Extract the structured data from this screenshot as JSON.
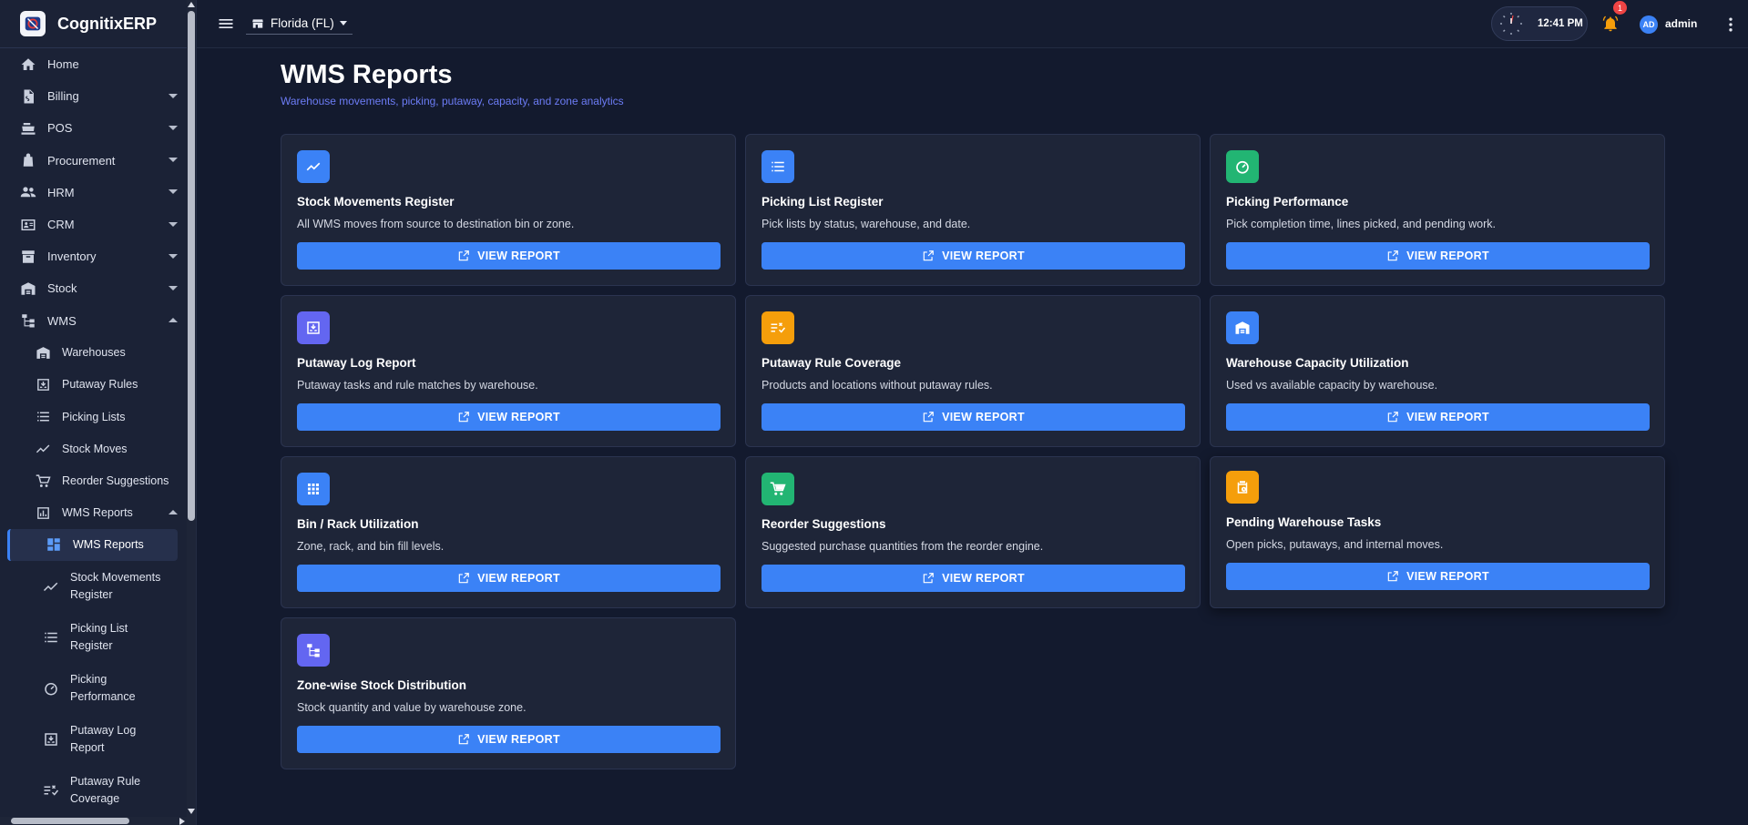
{
  "brand": {
    "name": "CognitixERP",
    "logo_icon": "cognitix-logo-icon"
  },
  "sidebar": {
    "items": [
      {
        "label": "Home",
        "icon": "home-icon"
      },
      {
        "label": "Billing",
        "icon": "receipt-icon"
      },
      {
        "label": "POS",
        "icon": "register-icon"
      },
      {
        "label": "Procurement",
        "icon": "bag-icon"
      },
      {
        "label": "HRM",
        "icon": "people-icon"
      },
      {
        "label": "CRM",
        "icon": "contact-card-icon"
      },
      {
        "label": "Inventory",
        "icon": "inventory-box-icon"
      },
      {
        "label": "Stock",
        "icon": "warehouse-icon"
      },
      {
        "label": "WMS",
        "icon": "hierarchy-icon"
      }
    ],
    "wms_children": [
      {
        "label": "Warehouses",
        "icon": "warehouse-icon"
      },
      {
        "label": "Putaway Rules",
        "icon": "putaway-icon"
      },
      {
        "label": "Picking Lists",
        "icon": "list-icon"
      },
      {
        "label": "Stock Moves",
        "icon": "trend-line-icon"
      },
      {
        "label": "Reorder Suggestions",
        "icon": "cart-icon"
      },
      {
        "label": "WMS Reports",
        "icon": "bar-chart-icon"
      }
    ],
    "report_children": [
      {
        "label": "WMS Reports",
        "icon": "dashboard-icon"
      },
      {
        "label_line1": "Stock Movements",
        "label_line2": "Register",
        "icon": "trend-line-icon"
      },
      {
        "label_line1": "Picking List",
        "label_line2": "Register",
        "icon": "list-icon"
      },
      {
        "label_line1": "Picking",
        "label_line2": "Performance",
        "icon": "speedometer-icon"
      },
      {
        "label_line1": "Putaway Log",
        "label_line2": "Report",
        "icon": "putaway-icon"
      },
      {
        "label_line1": "Putaway Rule",
        "label_line2": "Coverage",
        "icon": "rule-check-icon"
      }
    ]
  },
  "topbar": {
    "store": "Florida (FL)",
    "time": "12:41 PM",
    "notification_count": "1",
    "avatar_initials": "AD",
    "user": "admin"
  },
  "page": {
    "title": "WMS Reports",
    "subtitle": "Warehouse movements, picking, putaway, capacity, and zone analytics"
  },
  "colors": {
    "accent": "#3b82f6",
    "blue_icon": "#3b82f6",
    "green_icon": "#22b573",
    "purple_icon": "#6366f1",
    "orange_icon": "#f59e0b"
  },
  "cards": [
    {
      "title": "Stock Movements Register",
      "desc": "All WMS moves from source to destination bin or zone.",
      "button": "VIEW REPORT",
      "icon": "trend-line-icon",
      "color": "#3b82f6"
    },
    {
      "title": "Picking List Register",
      "desc": "Pick lists by status, warehouse, and date.",
      "button": "VIEW REPORT",
      "icon": "list-icon",
      "color": "#3b82f6"
    },
    {
      "title": "Picking Performance",
      "desc": "Pick completion time, lines picked, and pending work.",
      "button": "VIEW REPORT",
      "icon": "speedometer-icon",
      "color": "#22b573"
    },
    {
      "title": "Putaway Log Report",
      "desc": "Putaway tasks and rule matches by warehouse.",
      "button": "VIEW REPORT",
      "icon": "putaway-icon",
      "color": "#6366f1"
    },
    {
      "title": "Putaway Rule Coverage",
      "desc": "Products and locations without putaway rules.",
      "button": "VIEW REPORT",
      "icon": "rule-check-icon",
      "color": "#f59e0b"
    },
    {
      "title": "Warehouse Capacity Utilization",
      "desc": "Used vs available capacity by warehouse.",
      "button": "VIEW REPORT",
      "icon": "warehouse-icon",
      "color": "#3b82f6"
    },
    {
      "title": "Bin / Rack Utilization",
      "desc": "Zone, rack, and bin fill levels.",
      "button": "VIEW REPORT",
      "icon": "grid-icon",
      "color": "#3b82f6"
    },
    {
      "title": "Reorder Suggestions",
      "desc": "Suggested purchase quantities from the reorder engine.",
      "button": "VIEW REPORT",
      "icon": "cart-icon",
      "color": "#22b573"
    },
    {
      "title": "Pending Warehouse Tasks",
      "desc": "Open picks, putaways, and internal moves.",
      "button": "VIEW REPORT",
      "icon": "clipboard-clock-icon",
      "color": "#f59e0b"
    },
    {
      "title": "Zone-wise Stock Distribution",
      "desc": "Stock quantity and value by warehouse zone.",
      "button": "VIEW REPORT",
      "icon": "hierarchy-icon",
      "color": "#6366f1"
    }
  ]
}
